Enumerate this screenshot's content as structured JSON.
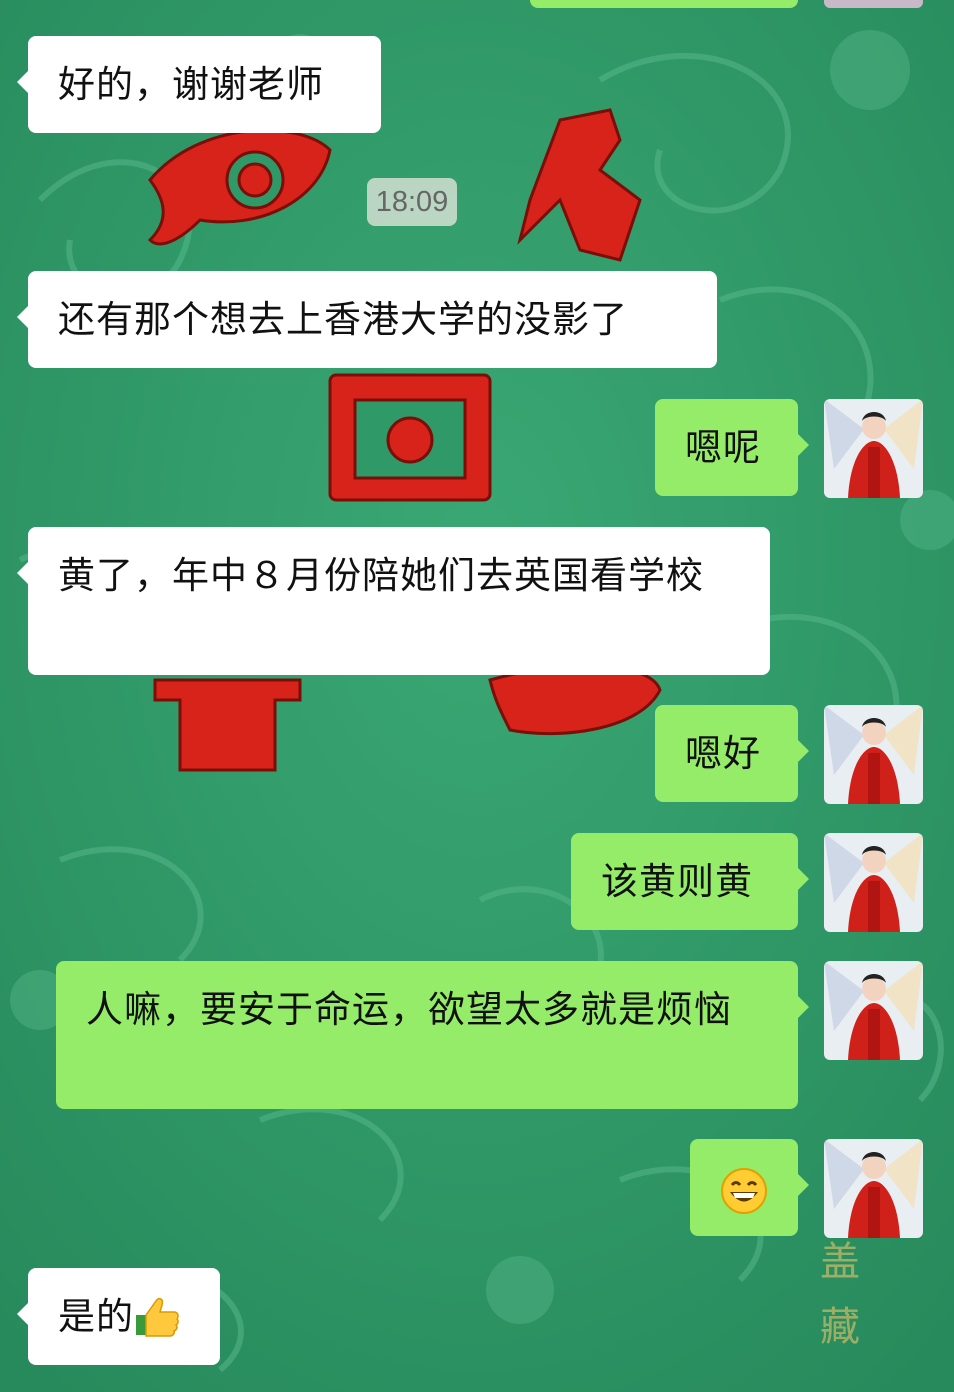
{
  "colors": {
    "background": "#2f9a67",
    "incoming_bubble": "#ffffff",
    "outgoing_bubble": "#95ec69",
    "decor_red": "#d8231b"
  },
  "chat": {
    "timestamp": "18:09",
    "messages": [
      {
        "side": "in",
        "text": "好的，谢谢老师"
      },
      {
        "side": "in",
        "text": "还有那个想去上香港大学的没影了"
      },
      {
        "side": "out",
        "text": "嗯呢",
        "avatar": "avatar-woman-red-robe"
      },
      {
        "side": "in",
        "text": "黄了，年中８月份陪她们去英国看学校"
      },
      {
        "side": "out",
        "text": "嗯好",
        "avatar": "avatar-woman-red-robe"
      },
      {
        "side": "out",
        "text": "该黄则黄",
        "avatar": "avatar-woman-red-robe"
      },
      {
        "side": "out",
        "text": "人嘛，要安于命运，欲望太多就是烦恼",
        "avatar": "avatar-woman-red-robe"
      },
      {
        "side": "out",
        "emoji": "grinning-face-icon",
        "avatar": "avatar-woman-red-robe"
      },
      {
        "side": "in",
        "text": "是的",
        "emoji": "thumbs-up-icon"
      }
    ]
  }
}
